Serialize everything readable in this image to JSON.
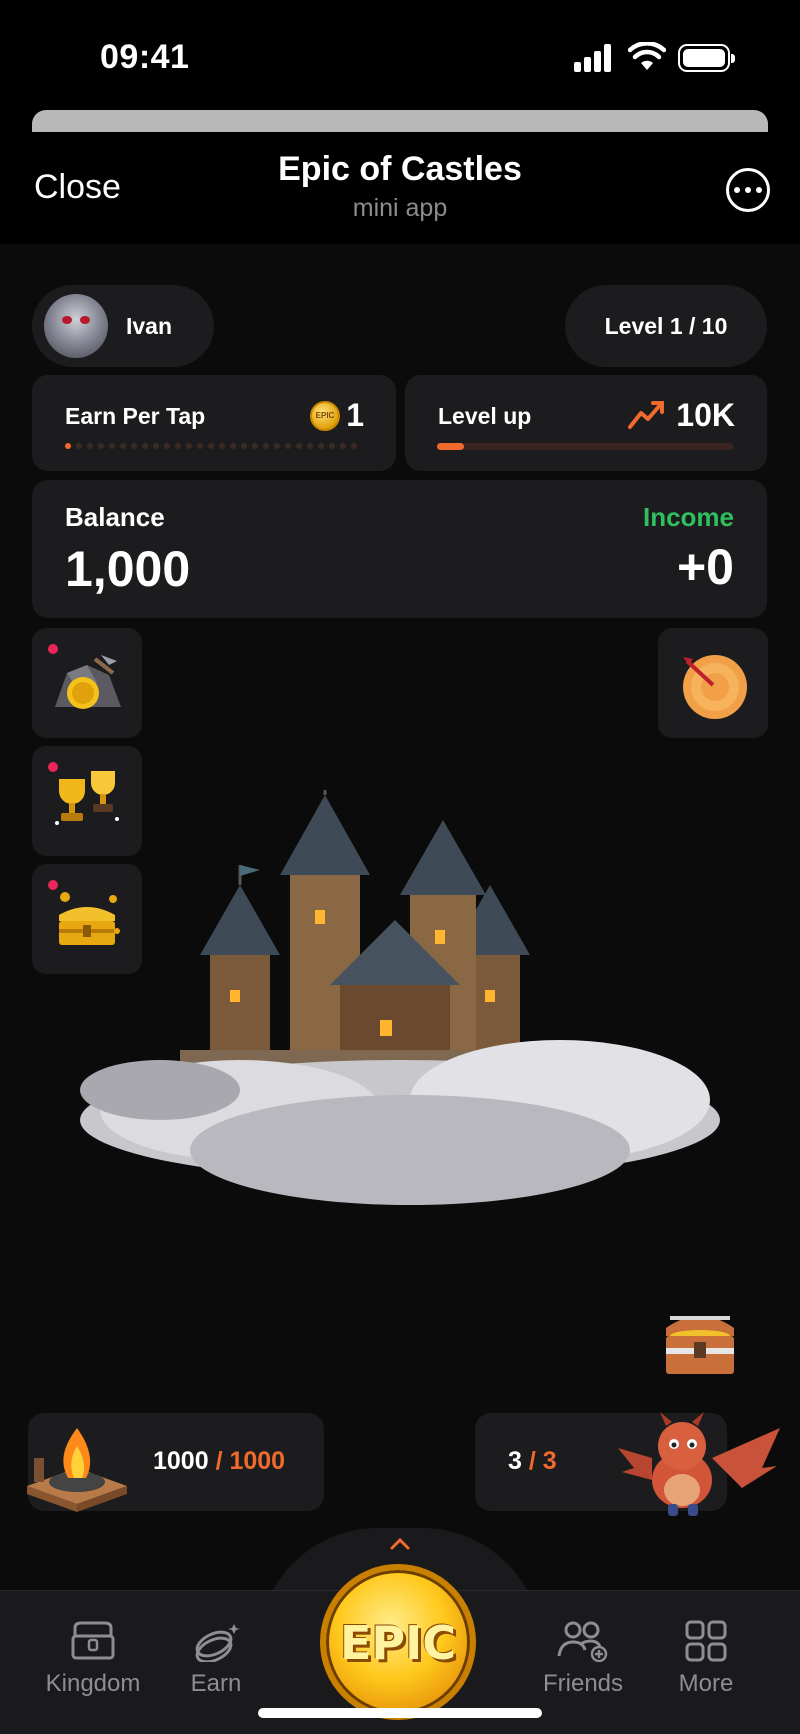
{
  "status": {
    "time": "09:41"
  },
  "header": {
    "close_label": "Close",
    "title": "Epic of Castles",
    "subtitle": "mini app"
  },
  "user": {
    "name": "Ivan",
    "level": "Level 1 / 10"
  },
  "earn_per_tap": {
    "label": "Earn Per Tap",
    "value": "1",
    "coin_text": "EPIC"
  },
  "level_up": {
    "label": "Level up",
    "value": "10K",
    "progress": 0.09
  },
  "balance": {
    "label": "Balance",
    "value": "1,000",
    "income_label": "Income",
    "income_value": "+0"
  },
  "energy": {
    "current": "1000",
    "max": "/ 1000"
  },
  "dragons": {
    "current": "3",
    "max": "/ 3"
  },
  "tap": {
    "label": "EPIC"
  },
  "nav": {
    "kingdom": "Kingdom",
    "earn": "Earn",
    "friends": "Friends",
    "more": "More"
  },
  "colors": {
    "accent": "#f06a2d",
    "income": "#2fbf5e",
    "badge": "#e8265a",
    "card": "#1c1c1f"
  }
}
